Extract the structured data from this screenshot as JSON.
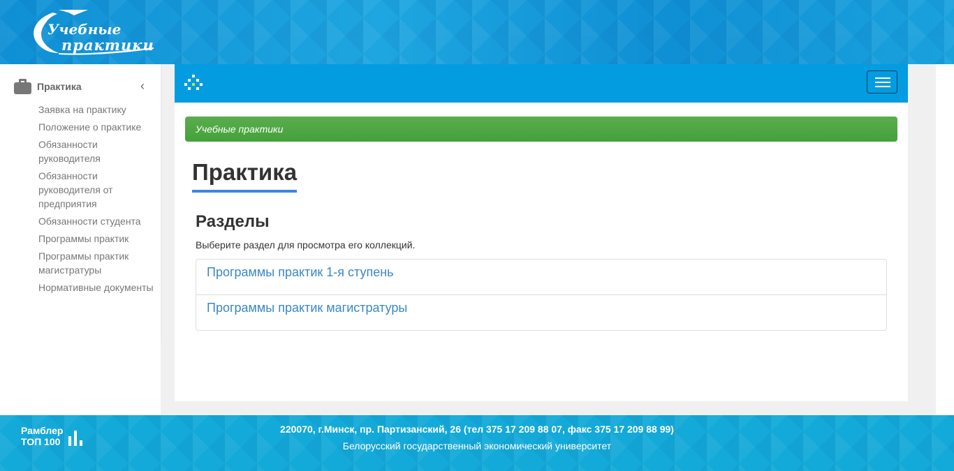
{
  "header": {
    "logo_line1": "Учебные",
    "logo_line2": "практики"
  },
  "sidebar": {
    "section_title": "Практика",
    "section_icon": "briefcase-icon",
    "collapse_icon": "chevron-left-icon",
    "items": [
      {
        "label": "Заявка на практику"
      },
      {
        "label": "Положение о практике"
      },
      {
        "label": "Обязанности руководителя"
      },
      {
        "label": "Обязанности руководителя от предприятия"
      },
      {
        "label": "Обязанности студента"
      },
      {
        "label": "Программы практик"
      },
      {
        "label": "Программы практик магистратуры"
      },
      {
        "label": "Нормативные документы"
      }
    ]
  },
  "navbar": {
    "logo_icon": "dots-logo-icon",
    "toggle_icon": "hamburger-menu-icon"
  },
  "breadcrumb": "Учебные практики",
  "main": {
    "title": "Практика",
    "section_heading": "Разделы",
    "section_description": "Выберите раздел для просмотра его коллекций.",
    "sections": [
      {
        "label": "Программы практик 1-я ступень"
      },
      {
        "label": "Программы практик магистратуры"
      }
    ]
  },
  "footer": {
    "counter_line1": "Рамблер",
    "counter_line2": "ТОП 100",
    "address": "220070, г.Минск, пр. Партизанский, 26 (тел 375 17 209 88 07, факс 375 17 209 88 99)",
    "university": "Белорусский государственный экономический университет"
  },
  "colors": {
    "banner": "#129ad9",
    "navbar": "#049ce0",
    "breadcrumb": "#4ca642",
    "title_underline": "#3a87e0",
    "link": "#3a87c8",
    "footer": "#13a9d8"
  }
}
